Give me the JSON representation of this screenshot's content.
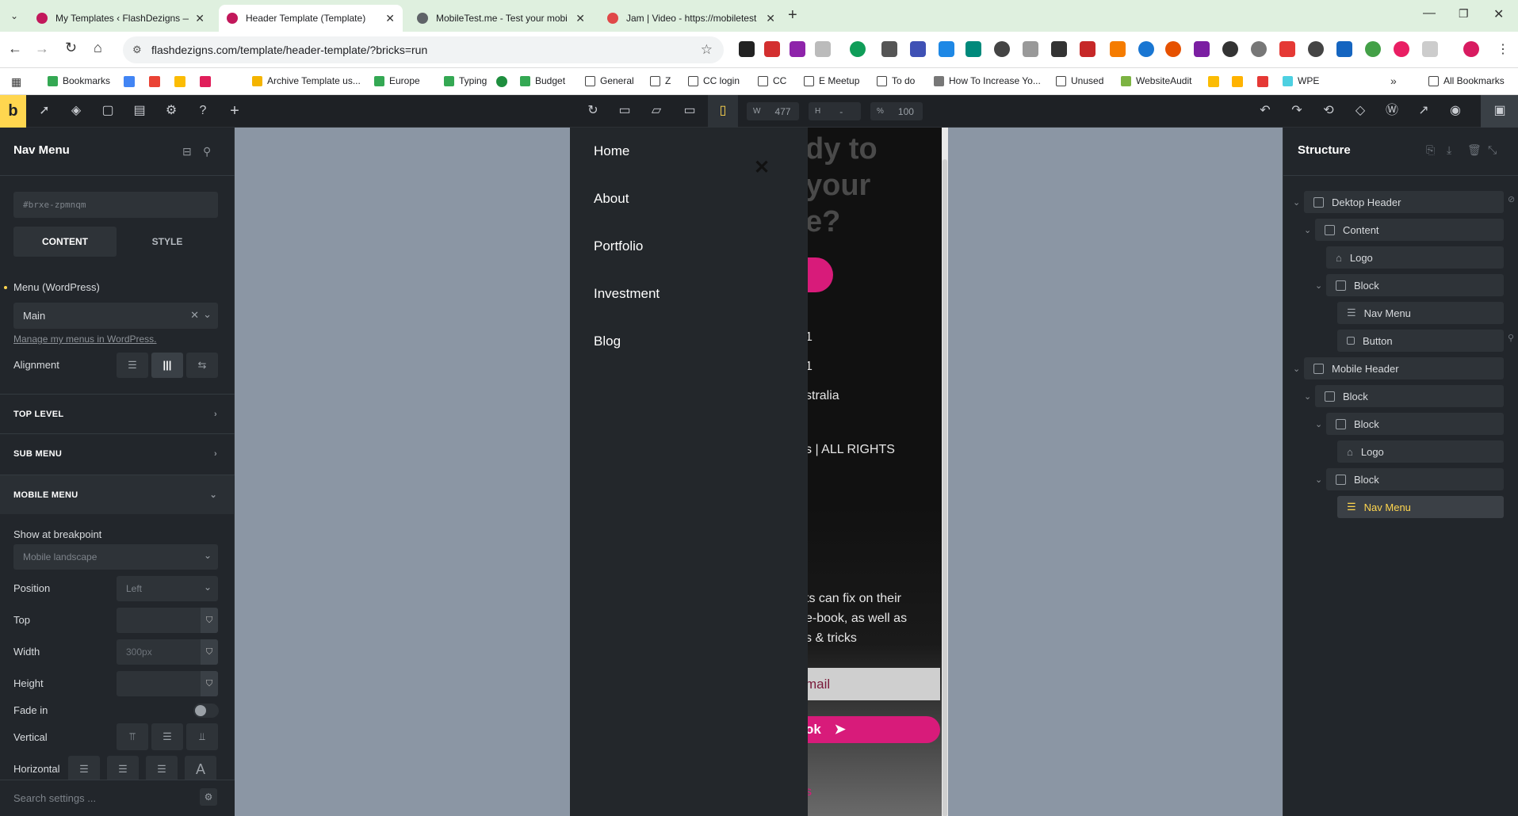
{
  "browser": {
    "tabs": [
      {
        "title": "My Templates ‹ FlashDezigns —",
        "color": "#c2185b"
      },
      {
        "title": "Header Template (Template)",
        "color": "#c2185b"
      },
      {
        "title": "MobileTest.me - Test your mobi",
        "color": "#5f6368"
      },
      {
        "title": "Jam | Video - https://mobiletest",
        "color": "#e04848"
      }
    ],
    "url": "flashdezigns.com/template/header-template/?bricks=run",
    "bookmarks": [
      "Bookmarks",
      "Archive Template us...",
      "Europe",
      "Typing",
      "Budget",
      "General",
      "Z",
      "CC login",
      "CC",
      "E Meetup",
      "To do",
      "How To Increase Yo...",
      "Unused",
      "WebsiteAudit",
      "WPE",
      "All Bookmarks"
    ]
  },
  "toolbar": {
    "width_label": "W",
    "width_value": "477",
    "height_label": "H",
    "height_value": "-",
    "percent_label": "%",
    "percent_value": "100",
    "accent": "#ffd64f"
  },
  "left_panel": {
    "title": "Nav Menu",
    "element_id": "#brxe-zpmnqm",
    "tabs": {
      "content": "CONTENT",
      "style": "STYLE"
    },
    "menu_label": "Menu (WordPress)",
    "menu_value": "Main",
    "manage_link": "Manage my menus in WordPress.",
    "alignment_label": "Alignment",
    "sections": {
      "top_level": "TOP LEVEL",
      "sub_menu": "SUB MENU",
      "mobile_menu": "MOBILE MENU"
    },
    "show_at_breakpoint_label": "Show at breakpoint",
    "breakpoint_value": "Mobile landscape",
    "position_label": "Position",
    "position_value": "Left",
    "top_label": "Top",
    "width_label": "Width",
    "width_placeholder": "300px",
    "height_label": "Height",
    "fade_in_label": "Fade in",
    "vertical_label": "Vertical",
    "horizontal_label": "Horizontal",
    "search_placeholder": "Search settings ..."
  },
  "preview": {
    "heading_lines": [
      "dy to",
      "your",
      "e?"
    ],
    "nav_items": [
      "Home",
      "About",
      "Portfolio",
      "Investment",
      "Blog"
    ],
    "footer_lines": [
      "1",
      "1",
      "stralia",
      "s | ALL RIGHTS"
    ],
    "promo_lines": [
      "ts can fix on their",
      "e-book, as well as",
      "s & tricks"
    ],
    "email_placeholder": "mail",
    "button_label": "ok",
    "bottom_link": "s"
  },
  "structure": {
    "title": "Structure",
    "nodes": [
      {
        "label": "Dektop Header"
      },
      {
        "label": "Content"
      },
      {
        "label": "Logo"
      },
      {
        "label": "Block"
      },
      {
        "label": "Nav Menu"
      },
      {
        "label": "Button"
      },
      {
        "label": "Mobile Header"
      },
      {
        "label": "Block"
      },
      {
        "label": "Block"
      },
      {
        "label": "Logo"
      },
      {
        "label": "Block"
      },
      {
        "label": "Nav Menu"
      }
    ]
  }
}
